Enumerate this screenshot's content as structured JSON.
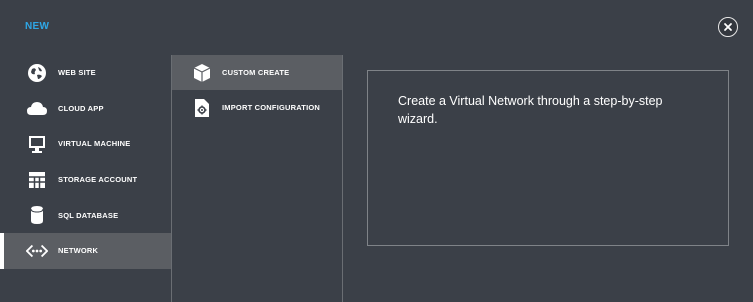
{
  "header": {
    "new_label": "NEW"
  },
  "close": {
    "icon": "close-icon"
  },
  "categories": [
    {
      "label": "WEB SITE",
      "icon": "globe-icon"
    },
    {
      "label": "CLOUD APP",
      "icon": "cloud-icon"
    },
    {
      "label": "VIRTUAL MACHINE",
      "icon": "monitor-icon"
    },
    {
      "label": "STORAGE ACCOUNT",
      "icon": "grid-icon"
    },
    {
      "label": "SQL DATABASE",
      "icon": "database-icon"
    },
    {
      "label": "NETWORK",
      "icon": "network-icon",
      "selected": true
    }
  ],
  "options": [
    {
      "label": "CUSTOM CREATE",
      "icon": "box-icon",
      "selected": true
    },
    {
      "label": "IMPORT CONFIGURATION",
      "icon": "gear-file-icon"
    }
  ],
  "description": {
    "text": "Create a Virtual Network through a step-by-step wizard."
  },
  "colors": {
    "background": "#3b4048",
    "selected": "#5b5e63",
    "accent": "#2fa7e6",
    "text": "#ffffff"
  }
}
